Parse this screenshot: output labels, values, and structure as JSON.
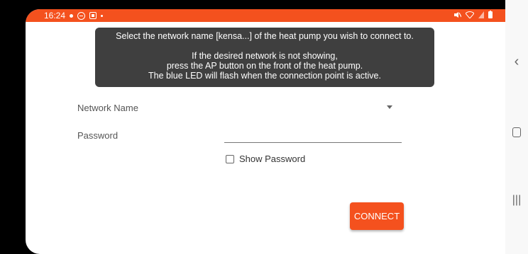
{
  "statusbar": {
    "time": "16:24",
    "icons_left": [
      "dot-icon",
      "do-not-disturb-icon",
      "notification-icon",
      "small-dot-icon"
    ],
    "icons_right": [
      "mute-icon",
      "wifi-icon",
      "signal-icon",
      "battery-icon"
    ]
  },
  "tooltip": {
    "line1": "Select the network name [kensa...] of the heat pump you wish to connect to.",
    "line2": "If the desired network is not showing,",
    "line3": "press the AP button on the front of the heat pump.",
    "line4": "The blue LED will flash when the connection point is active."
  },
  "form": {
    "network_label": "Network Name",
    "network_value": "",
    "password_label": "Password",
    "password_value": "",
    "show_password_label": "Show Password",
    "show_password_checked": false,
    "connect_label": "CONNECT"
  },
  "navbar": {
    "back_icon": "back-icon",
    "home_icon": "home-icon",
    "recent_icon": "recent-apps-icon"
  },
  "colors": {
    "accent": "#f4511e",
    "tooltip_bg": "#3f3f3f"
  }
}
